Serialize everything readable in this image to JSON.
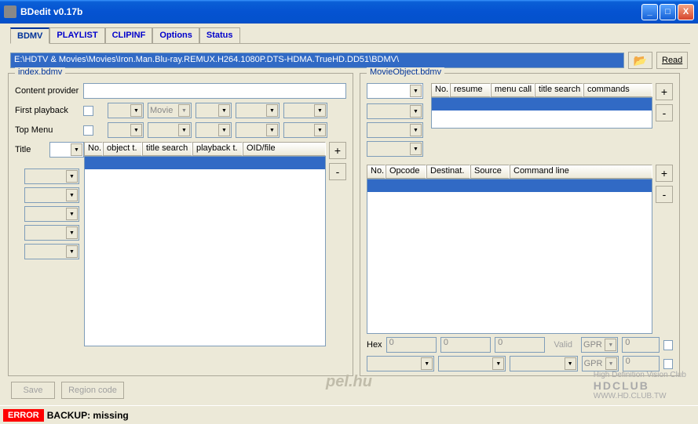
{
  "title": "BDedit v0.17b",
  "tabs": [
    "BDMV",
    "PLAYLIST",
    "CLIPINF",
    "Options",
    "Status"
  ],
  "path": "E:\\HDTV & Movies\\Movies\\Iron.Man.Blu-ray.REMUX.H264.1080P.DTS-HDMA.TrueHD.DD51\\BDMV\\",
  "read_btn": "Read",
  "index_panel": {
    "title": "index.bdmv",
    "content_provider_lbl": "Content provider",
    "first_playback_lbl": "First playback",
    "movie_opt": "Movie",
    "top_menu_lbl": "Top Menu",
    "title_lbl": "Title",
    "cols": {
      "no": "No.",
      "obj": "object t.",
      "ts": "title search",
      "pb": "playback t.",
      "oid": "OID/file"
    }
  },
  "movieobj_panel": {
    "title": "MovieObject.bdmv",
    "cols1": {
      "no": "No.",
      "resume": "resume",
      "menu": "menu call",
      "ts": "title search",
      "cmd": "commands"
    },
    "cols2": {
      "no": "No.",
      "op": "Opcode",
      "dest": "Destinat.",
      "src": "Source",
      "cmd": "Command line"
    },
    "hex_lbl": "Hex",
    "hex0": "0",
    "valid": "Valid",
    "gpr": "GPR",
    "zero": "0"
  },
  "save_btn": "Save",
  "region_btn": "Region code",
  "error_tag": "ERROR",
  "status_text": "BACKUP: missing",
  "watermark": "pel.hu"
}
